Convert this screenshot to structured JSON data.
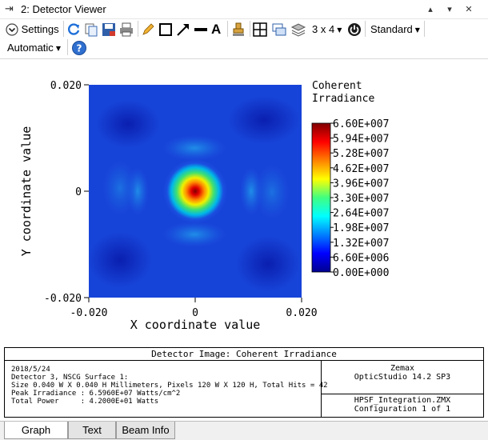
{
  "window": {
    "title": "2: Detector Viewer",
    "pin_glyph": "⇥",
    "controls": [
      "▴",
      "▾",
      "✕"
    ]
  },
  "toolbar": {
    "settings_label": "Settings",
    "layout_label": "3 x 4",
    "style_label": "Standard",
    "automatic_label": "Automatic",
    "text_tool_glyph": "A",
    "help_glyph": "?"
  },
  "colors": {
    "blue_icon": "#1e6fd9",
    "jet_low": "#00008f",
    "jet_high": "#800000"
  },
  "chart_data": {
    "type": "heatmap",
    "xlabel": "X coordinate value",
    "ylabel": "Y coordinate value",
    "xlim": [
      -0.02,
      0.02
    ],
    "ylim": [
      -0.02,
      0.02
    ],
    "x_ticks": [
      "-0.020",
      "0",
      "0.020"
    ],
    "y_ticks": [
      "0.020",
      "0",
      "-0.020"
    ],
    "legend_title": [
      "Coherent",
      "Irradiance"
    ],
    "legend_ticks": [
      "6.60E+007",
      "5.94E+007",
      "5.28E+007",
      "4.62E+007",
      "3.96E+007",
      "3.30E+007",
      "2.64E+007",
      "1.98E+007",
      "1.32E+007",
      "6.60E+006",
      "0.00E+000"
    ],
    "value_range": [
      0,
      66000000.0
    ],
    "peak_value": 65960000.0,
    "peak_location": [
      0,
      0
    ]
  },
  "info": {
    "header": "Detector Image: Coherent Irradiance",
    "lines": [
      "2018/5/24",
      "Detector 3, NSCG Surface 1:",
      "Size 0.040 W X 0.040 H Millimeters, Pixels 120 W X 120 H, Total Hits = 42",
      "Peak Irradiance : 6.5960E+07 Watts/cm^2",
      "Total Power     : 4.2000E+01 Watts"
    ],
    "vendor": "Zemax",
    "product": "OpticStudio 14.2 SP3",
    "file": "HPSF_Integration.ZMX",
    "config": "Configuration 1 of 1"
  },
  "tabs": [
    {
      "label": "Graph",
      "active": true
    },
    {
      "label": "Text",
      "active": false
    },
    {
      "label": "Beam Info",
      "active": false
    }
  ]
}
